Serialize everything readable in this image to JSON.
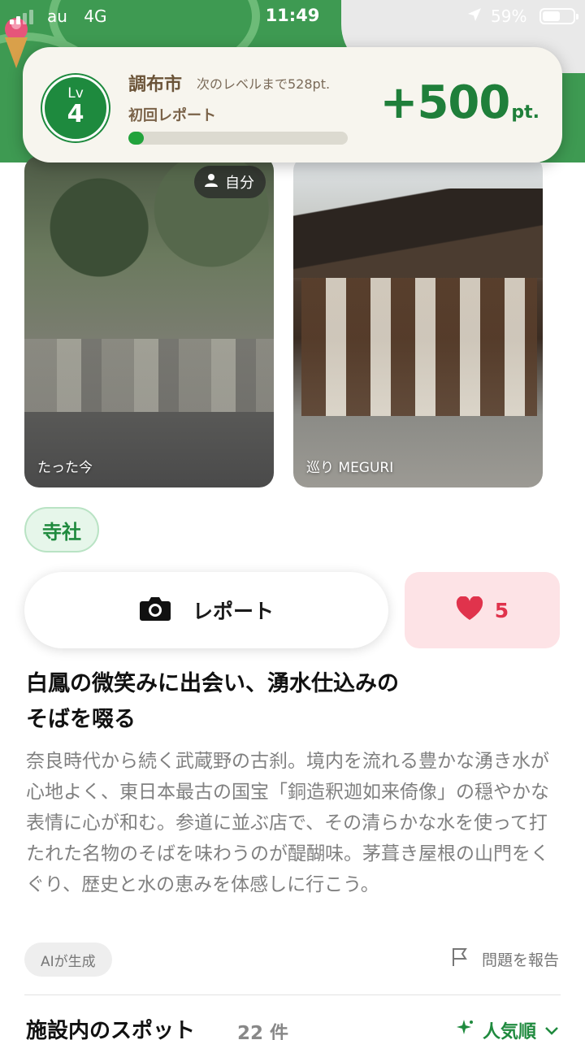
{
  "status_bar": {
    "carrier": "au",
    "network": "4G",
    "time": "11:49",
    "battery": "59%",
    "battery_level": 0.59
  },
  "level_card": {
    "level_label": "Lv",
    "level": "4",
    "city": "調布市",
    "next_level_text": "次のレベルまで528pt.",
    "achievement": "初回レポート",
    "progress": 0.07,
    "points": "+500",
    "points_unit": "pt."
  },
  "photos": [
    {
      "caption": "たった今",
      "chip_label": "自分"
    },
    {
      "caption": "巡り MEGURI"
    }
  ],
  "tag": "寺社",
  "actions": {
    "report_label": "レポート",
    "like_count": "5"
  },
  "article": {
    "title_line1": "白鳳の微笑みに出会い、湧水仕込みの",
    "title_line2": "そばを啜る",
    "description": "奈良時代から続く武蔵野の古刹。境内を流れる豊かな湧き水が心地よく、東日本最古の国宝「銅造釈迦如来倚像」の穏やかな表情に心が和む。参道に並ぶ店で、その清らかな水を使って打たれた名物のそばを味わうのが醍醐味。茅葺き屋根の山門をくぐり、歴史と水の恵みを体感しに行こう。",
    "ai_label": "AIが生成",
    "report_issue": "問題を報告"
  },
  "spots": {
    "title": "施設内のスポット",
    "count": "22 件",
    "sort_label": "人気順"
  },
  "colors": {
    "accent_green": "#1f8a3e",
    "like_red": "#e0334c",
    "points_green": "#1f7f3a"
  }
}
